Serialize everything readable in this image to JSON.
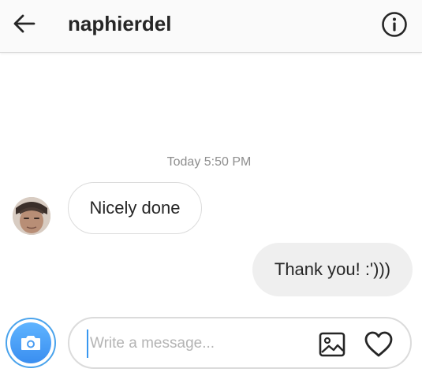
{
  "header": {
    "title": "naphierdel",
    "back_icon": "arrow-left-icon",
    "info_icon": "info-circle-icon"
  },
  "thread": {
    "timestamp": "Today 5:50 PM",
    "messages": [
      {
        "direction": "incoming",
        "text": "Nicely done"
      },
      {
        "direction": "outgoing",
        "text": "Thank you! :')))"
      }
    ]
  },
  "composer": {
    "placeholder": "Write a message...",
    "value": "",
    "camera_icon": "camera-icon",
    "gallery_icon": "image-icon",
    "like_icon": "heart-icon"
  },
  "colors": {
    "accent": "#3897f0",
    "camera_gradient_top": "#5fb4ff",
    "camera_gradient_bottom": "#3a8ef0",
    "outgoing_bubble": "#efefef",
    "border": "#dbdbdb",
    "timestamp": "#8e8e8e"
  }
}
